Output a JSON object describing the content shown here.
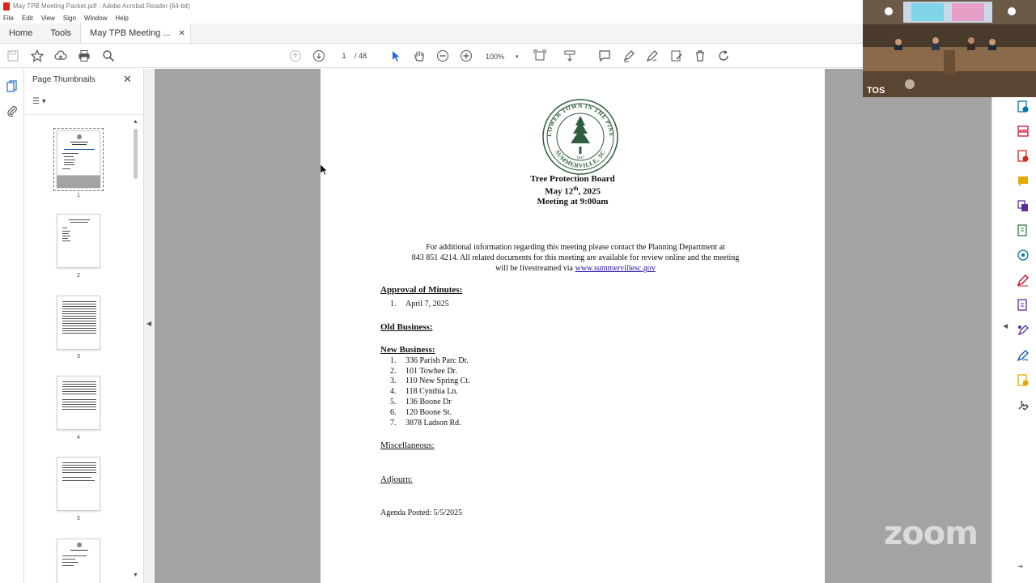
{
  "window": {
    "title": "May TPB Meeting Packet.pdf - Adobe Acrobat Reader (64-bit)"
  },
  "menu": [
    "File",
    "Edit",
    "View",
    "Sign",
    "Window",
    "Help"
  ],
  "tabs": {
    "home": "Home",
    "tools": "Tools",
    "document": "May TPB Meeting ...",
    "close": "✕"
  },
  "toolbar": {
    "current_page": "1",
    "total_pages": "/ 48",
    "zoom": "100%"
  },
  "thumbnails": {
    "title": "Page Thumbnails",
    "close": "✕",
    "pages": [
      "1",
      "2",
      "3",
      "4",
      "5"
    ]
  },
  "document": {
    "seal_text": "FLOWER TOWN IN THE PINES",
    "seal_bottom": "SUMMERVILLE, SC",
    "seal_year": "1847",
    "board": "Tree Protection Board",
    "date_prefix": "May 12",
    "date_sup": "th",
    "date_suffix": ", 2025",
    "meeting_time": "Meeting at 9:00am",
    "info_line1": "For additional information regarding this meeting please contact the Planning Department at",
    "info_line2": "843 851 4214. All related documents for this meeting are available for review online and the meeting",
    "info_line3": "will be livestreamed via",
    "info_link": "www.summervillesc.gov",
    "approval_heading": "Approval of Minutes:",
    "approval_items": [
      {
        "num": "1.",
        "text": "April 7, 2025"
      }
    ],
    "old_business_heading": "Old Business:",
    "new_business_heading": "New Business:",
    "new_business_items": [
      {
        "num": "1.",
        "text": "336 Parish Parc Dr."
      },
      {
        "num": "2.",
        "text": "101 Towhee Dr."
      },
      {
        "num": "3.",
        "text": "110 New Spring Ct."
      },
      {
        "num": "4.",
        "text": "118 Cynthia Ln."
      },
      {
        "num": "5.",
        "text": "136 Boone Dr"
      },
      {
        "num": "6.",
        "text": "120 Boone St."
      },
      {
        "num": "7.",
        "text": "3878 Ladson Rd."
      }
    ],
    "misc_heading": "Miscellaneous:",
    "adjourn_heading": "Adjourn:",
    "agenda_posted": "Agenda Posted: 5/5/2025"
  },
  "video": {
    "participant_label": "TOS"
  },
  "watermark": "zoom",
  "colors": {
    "doc_background": "#a3a3a3",
    "acrobat_red": "#d7261f",
    "tool_icons": [
      "#2d7d46",
      "#c8102e",
      "#d7261f",
      "#e8a800",
      "#5a2ca0",
      "#2d7d46",
      "#0078a8",
      "#c8102e",
      "#5a2ca0",
      "#e8a800",
      "#2d7d46",
      "#0050b3",
      "#444444"
    ]
  }
}
